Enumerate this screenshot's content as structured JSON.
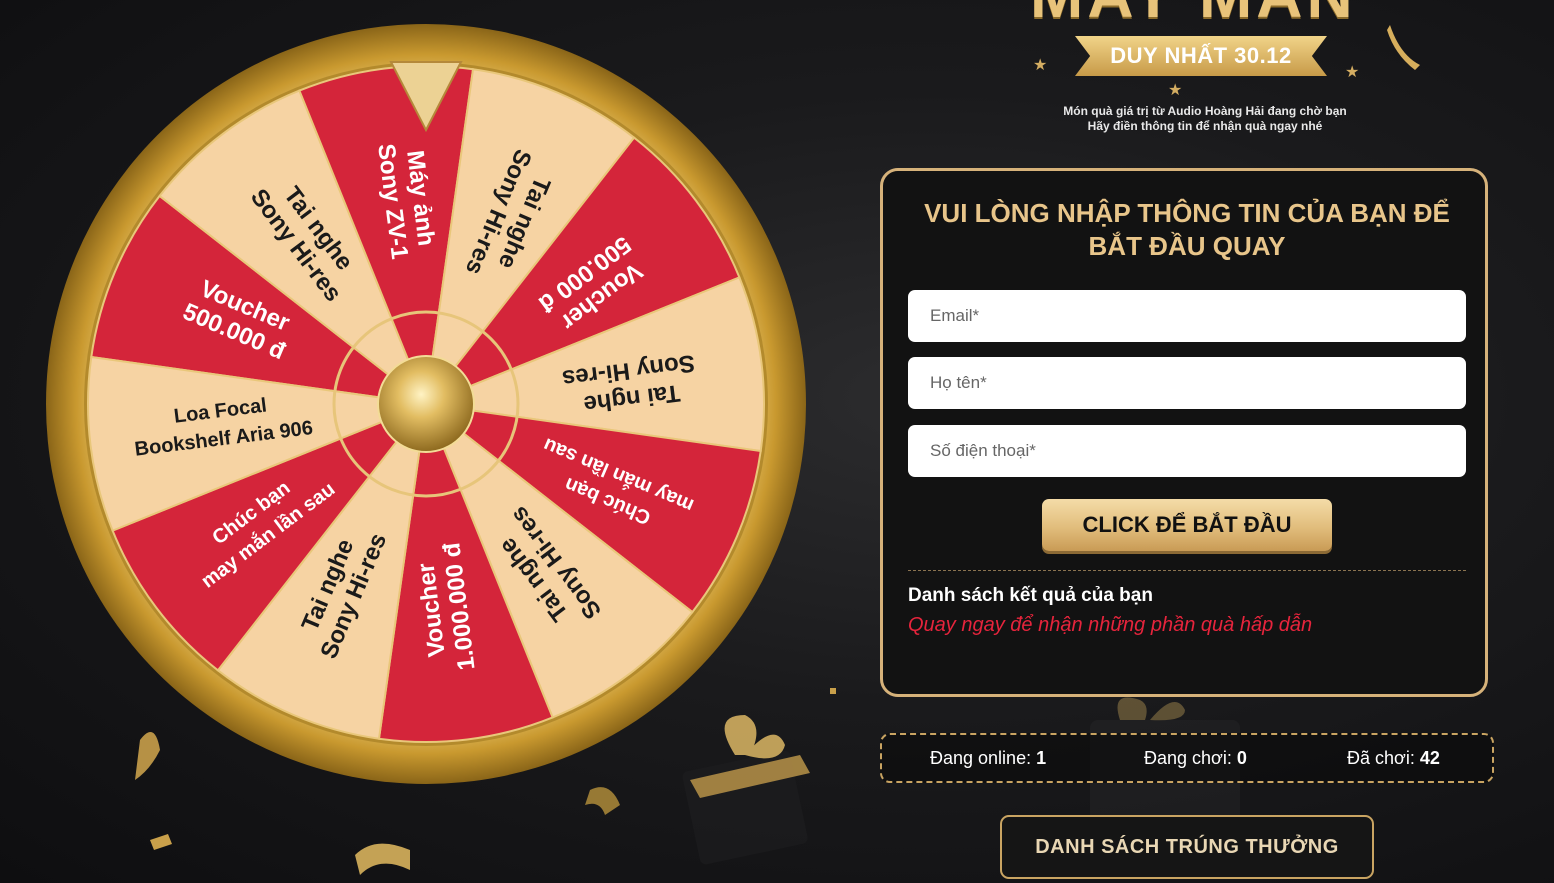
{
  "header": {
    "title": "MAY MẮN",
    "ribbon": "DUY NHẤT 30.12",
    "subtitle_line1": "Món quà giá trị từ Audio Hoàng Hải đang chờ bạn",
    "subtitle_line2": "Hãy điền thông tin để nhận quà ngay nhé"
  },
  "form": {
    "title_line1": "VUI LÒNG NHẬP THÔNG TIN CỦA BẠN ĐỂ",
    "title_line2": "BẮT ĐẦU QUAY",
    "email_placeholder": "Email*",
    "name_placeholder": "Họ tên*",
    "phone_placeholder": "Số điện thoại*",
    "start_label": "CLICK ĐỂ BẮT ĐẦU",
    "results_title": "Danh sách kết quả của bạn",
    "results_hint": "Quay ngay để nhận những phần quà hấp dẫn"
  },
  "stats": {
    "online_label": "Đang online:",
    "online_value": "1",
    "playing_label": "Đang chơi:",
    "playing_value": "0",
    "played_label": "Đã chơi:",
    "played_value": "42"
  },
  "winners_button": "DANH SÁCH TRÚNG THƯỞNG",
  "wheel": {
    "colors": {
      "red": "#d4253a",
      "cream": "#f6d3a3",
      "rim": "#d9b15a",
      "hub": "#c9a04a"
    },
    "segments": [
      {
        "l1": "Voucher",
        "l2": "500.000 đ",
        "color": "red"
      },
      {
        "l1": "Tai nghe",
        "l2": "Sony Hi-res",
        "color": "cream"
      },
      {
        "l1": "Máy ảnh",
        "l2": "Sony ZV-1",
        "color": "red"
      },
      {
        "l1": "Tai nghe",
        "l2": "Sony Hi-res",
        "color": "cream"
      },
      {
        "l1": "Voucher",
        "l2": "500.000 đ",
        "color": "red"
      },
      {
        "l1": "Tai nghe",
        "l2": "Sony Hi-res",
        "color": "cream"
      },
      {
        "l1": "Chúc bạn",
        "l2": "may mắn lần sau",
        "color": "red"
      },
      {
        "l1": "Tai nghe",
        "l2": "Sony Hi-res",
        "color": "cream"
      },
      {
        "l1": "Voucher",
        "l2": "1.000.000 đ",
        "color": "red"
      },
      {
        "l1": "Tai nghe",
        "l2": "Sony Hi-res",
        "color": "cream"
      },
      {
        "l1": "Chúc bạn",
        "l2": "may mắn lần sau",
        "color": "red"
      },
      {
        "l1": "Loa Focal",
        "l2": "Bookshelf Aria 906",
        "color": "cream"
      }
    ]
  }
}
